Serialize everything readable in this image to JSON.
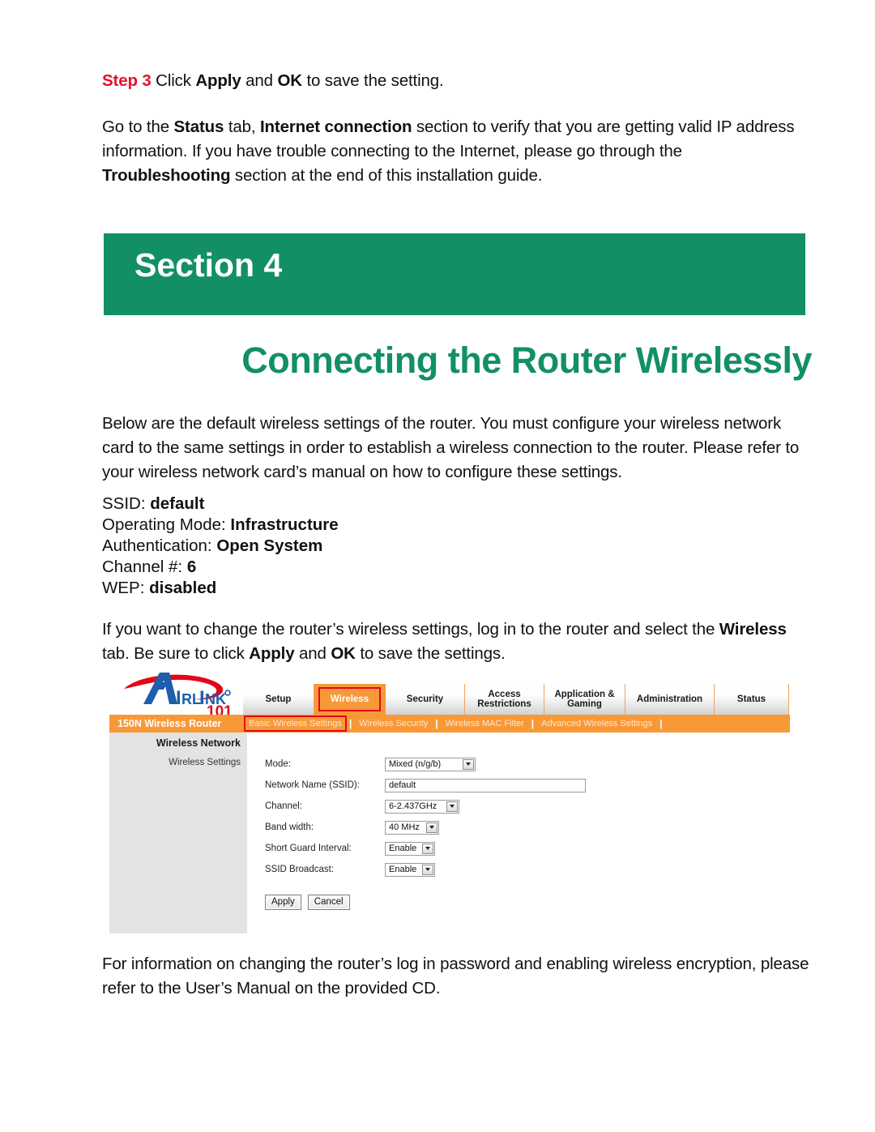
{
  "step3": {
    "label": "Step 3",
    "text_before_apply": " Click ",
    "apply": "Apply",
    "and": " and ",
    "ok": "OK",
    "text_after": " to save the setting."
  },
  "status_paragraph": {
    "p1": "Go to the ",
    "b1": "Status",
    "p2": " tab, ",
    "b2": "Internet connection",
    "p3": " section to verify that you are getting valid IP address information.  If you have trouble connecting to the Internet, please go through the ",
    "b3": "Troubleshooting",
    "p4": " section at the end of this installation guide."
  },
  "section": {
    "banner_text": "Section 4",
    "title": "Connecting the Router Wirelessly"
  },
  "intro_paragraph": {
    "text": "Below are the default wireless settings of the router. You must configure your wireless network card to the same settings in order to establish a wireless connection to the router. Please refer to your wireless network card’s manual on how to configure these settings."
  },
  "defaults": [
    {
      "label": "SSID:",
      "value": "default"
    },
    {
      "label": "Operating Mode:",
      "value": "Infrastructure"
    },
    {
      "label": "Authentication:",
      "value": "Open System"
    },
    {
      "label": "Channel #:",
      "value": "6"
    },
    {
      "label": "WEP:",
      "value": "disabled"
    }
  ],
  "change_paragraph": {
    "p1": "If you want to change the router’s wireless settings, log in to the router and select the ",
    "b1": "Wireless",
    "p2": " tab. Be sure to click ",
    "b2": "Apply",
    "p3": " and ",
    "b3": "OK",
    "p4": " to save the settings."
  },
  "router_ui": {
    "logo": {
      "a_letter": "A",
      "word": "IRLINK",
      "registered": "®",
      "number": "101"
    },
    "tabs": [
      {
        "label": "Setup",
        "active": false,
        "width_class": "tab-w-setup"
      },
      {
        "label": "Wireless",
        "active": true,
        "width_class": "tab-w-wireless"
      },
      {
        "label": "Security",
        "active": false,
        "width_class": "tab-w-security"
      },
      {
        "label": "Access\nRestrictions",
        "active": false,
        "width_class": "tab-w-access"
      },
      {
        "label": "Application &\nGaming",
        "active": false,
        "width_class": "tab-w-app"
      },
      {
        "label": "Administration",
        "active": false,
        "width_class": "tab-w-admin"
      },
      {
        "label": "Status",
        "active": false,
        "width_class": "tab-w-status"
      }
    ],
    "subnav": {
      "brand": "150N Wireless Router",
      "items": [
        {
          "label": "Basic Wireless Settings",
          "active": true
        },
        {
          "label": "Wireless Security",
          "active": false
        },
        {
          "label": "Wireless MAC Filter",
          "active": false
        },
        {
          "label": "Advanced Wireless Settings",
          "active": false
        }
      ],
      "separator": "|"
    },
    "panel": {
      "heading": "Wireless Network",
      "subheading": "Wireless Settings"
    },
    "form": [
      {
        "label": "Mode:",
        "type": "select",
        "value": "Mixed (n/g/b)",
        "size_class": "sel-mode"
      },
      {
        "label": "Network Name (SSID):",
        "type": "text",
        "value": "default",
        "size_class": ""
      },
      {
        "label": "Channel:",
        "type": "select",
        "value": "6-2.437GHz",
        "size_class": "sel-channel"
      },
      {
        "label": "Band width:",
        "type": "select",
        "value": "40 MHz",
        "size_class": "sel-band"
      },
      {
        "label": "Short Guard Interval:",
        "type": "select",
        "value": "Enable",
        "size_class": "sel-sgi"
      },
      {
        "label": "SSID Broadcast:",
        "type": "select",
        "value": "Enable",
        "size_class": "sel-ssidbc"
      }
    ],
    "buttons": {
      "apply": "Apply",
      "cancel": "Cancel"
    }
  },
  "closing_paragraph": {
    "text": "For information on changing the router’s log in password and enabling wireless encryption, please refer to the User’s Manual on the provided CD."
  },
  "colors": {
    "section_green": "#129064",
    "step_red": "#e8112d",
    "router_orange": "#f89938",
    "highlight_red": "#e3071a",
    "panel_gray": "#e3e3e3"
  }
}
